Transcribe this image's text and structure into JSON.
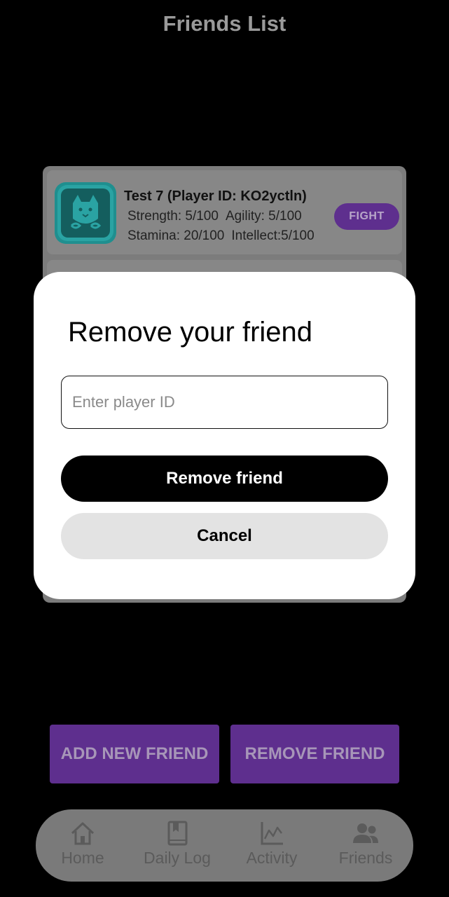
{
  "header": {
    "title": "Friends List"
  },
  "friends": [
    {
      "name": "Test 7 (Player ID: KO2yctln)",
      "strength": "Strength: 5/100",
      "agility": "Agility: 5/100",
      "stamina": "Stamina: 20/100",
      "intellect": "Intellect:5/100",
      "fight_label": "FIGHT",
      "avatar_icon": "cat-avatar-icon"
    }
  ],
  "dialog": {
    "title": "Remove your friend",
    "input_placeholder": "Enter player ID",
    "input_value": "",
    "confirm_label": "Remove friend",
    "cancel_label": "Cancel"
  },
  "actions": {
    "add_label": "ADD NEW FRIEND",
    "remove_label": "REMOVE FRIEND"
  },
  "nav": {
    "items": [
      {
        "label": "Home",
        "icon": "home-icon"
      },
      {
        "label": "Daily Log",
        "icon": "book-icon"
      },
      {
        "label": "Activity",
        "icon": "chart-icon"
      },
      {
        "label": "Friends",
        "icon": "people-icon"
      }
    ]
  },
  "colors": {
    "accent_purple": "#5e2f8e",
    "dialog_bg": "#ffffff",
    "avatar_teal": "#1f8f8f"
  }
}
